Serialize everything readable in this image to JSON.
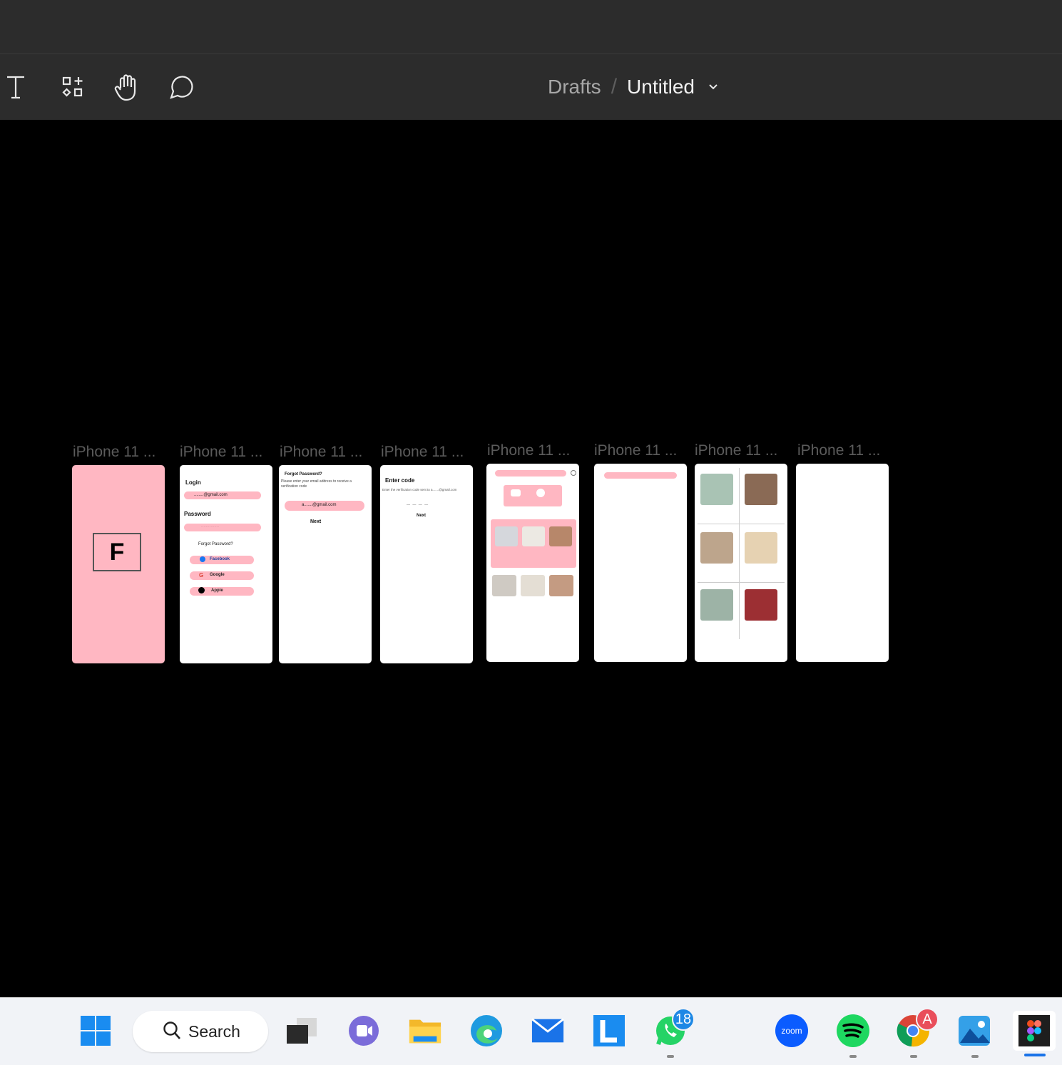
{
  "toolbar": {
    "tools": [
      "text-tool",
      "resources-tool",
      "hand-tool",
      "comment-tool"
    ],
    "breadcrumb": {
      "parent": "Drafts",
      "separator": "/",
      "title": "Untitled"
    }
  },
  "canvas": {
    "frames": [
      {
        "label": "iPhone 11 ...",
        "kind": "splash",
        "logo": "F"
      },
      {
        "label": "iPhone 11 ...",
        "kind": "login",
        "heading": "Login",
        "field_value": "........@gmail.com",
        "password_label": "Password",
        "password_value": "...............",
        "forgot": "Forgot Password?",
        "social": [
          "Facebook",
          "Google",
          "Apple"
        ]
      },
      {
        "label": "iPhone 11 ...",
        "kind": "forgot",
        "heading": "Forgot Password?",
        "text": "Please enter your email address to receive a verification code",
        "field_value": "a.......@gmail.com",
        "button": "Next"
      },
      {
        "label": "iPhone 11 ...",
        "kind": "code",
        "heading": "Enter code",
        "text": "Enter the verification code sent to a.......@gmail.com",
        "dashes": "— — — —",
        "button": "Next"
      },
      {
        "label": "iPhone 11 ...",
        "kind": "home"
      },
      {
        "label": "iPhone 11 ...",
        "kind": "search"
      },
      {
        "label": "iPhone 11 ...",
        "kind": "grid"
      },
      {
        "label": "iPhone 11 ...",
        "kind": "blank"
      }
    ]
  },
  "taskbar": {
    "search_label": "Search",
    "apps": [
      "windows-start",
      "task-view",
      "teams",
      "file-explorer",
      "edge",
      "mail",
      "lexis",
      "whatsapp",
      "zoom",
      "spotify",
      "chrome",
      "photos",
      "figma"
    ],
    "whatsapp_badge": "18",
    "chrome_badge": "A",
    "zoom_label": "zoom"
  }
}
